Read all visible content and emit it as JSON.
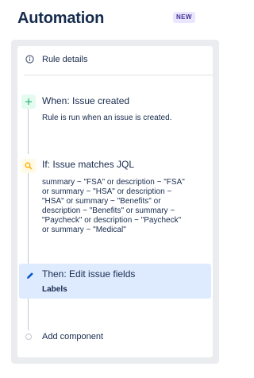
{
  "header": {
    "title": "Automation",
    "badge": "NEW"
  },
  "rule_details": {
    "label": "Rule details",
    "icon": "info-icon"
  },
  "trigger": {
    "title": "When: Issue created",
    "description": "Rule is run when an issue is created.",
    "icon": "plus-icon",
    "color": "#36b37e"
  },
  "condition": {
    "title": "If: Issue matches JQL",
    "jql_lines": [
      "summary ~ \"FSA\" or description ~ \"FSA\"",
      "or summary ~ \"HSA\" or description ~",
      "\"HSA\" or summary ~ \"Benefits\" or",
      "description ~ \"Benefits\" or summary ~",
      "\"Paycheck\" or description ~ \"Paycheck\"",
      "or summary ~ \"Medical\""
    ],
    "icon": "search-icon",
    "color": "#ffab00"
  },
  "action": {
    "title": "Then: Edit issue fields",
    "detail": "Labels",
    "icon": "pencil-icon",
    "color": "#0052cc"
  },
  "add_component": {
    "label": "Add component"
  }
}
